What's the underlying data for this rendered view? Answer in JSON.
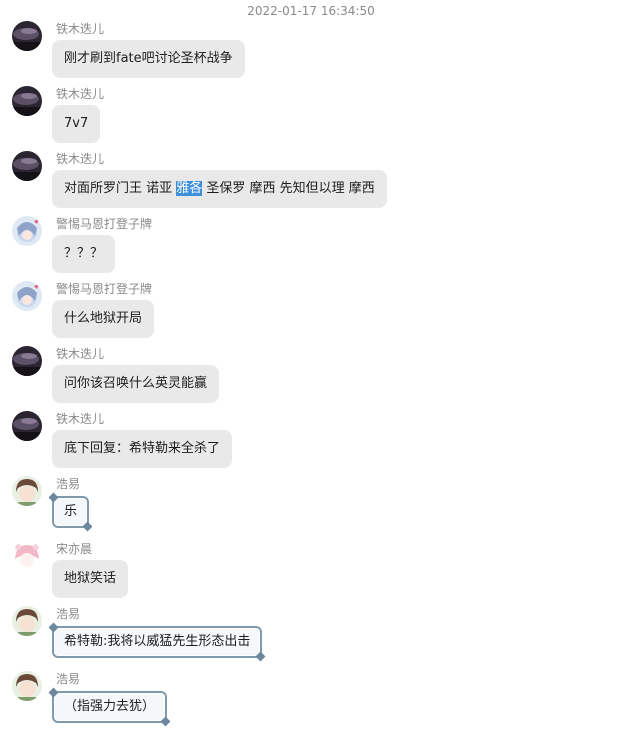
{
  "chat": {
    "timestamp": "2022-01-17 16:34:50",
    "messages": [
      {
        "sender": "铁木迭儿",
        "text": "刚才刷到fate吧讨论圣杯战争",
        "avatar": "night-sky-avatar"
      },
      {
        "sender": "铁木迭儿",
        "text": "7v7",
        "avatar": "night-sky-avatar"
      },
      {
        "sender": "铁木迭儿",
        "text_before": "对面所罗门王 诺亚 ",
        "text_highlight": "雅各",
        "text_after": " 圣保罗 摩西 先知但以理 摩西",
        "avatar": "night-sky-avatar"
      },
      {
        "sender": "警惕马恩打登子牌",
        "text": "？？？",
        "avatar": "anime-girl-avatar"
      },
      {
        "sender": "警惕马恩打登子牌",
        "text": "什么地狱开局",
        "avatar": "anime-girl-avatar"
      },
      {
        "sender": "铁木迭儿",
        "text": "问你该召唤什么英灵能赢",
        "avatar": "night-sky-avatar"
      },
      {
        "sender": "铁木迭儿",
        "text": "底下回复：希特勒来全杀了",
        "avatar": "night-sky-avatar"
      },
      {
        "sender": "浩易",
        "text": "乐",
        "avatar": "anime-boy-avatar"
      },
      {
        "sender": "宋亦晨",
        "text": "地狱笑话",
        "avatar": "pink-hair-avatar"
      },
      {
        "sender": "浩易",
        "text": "希特勒:我将以威猛先生形态出击",
        "avatar": "anime-boy-avatar"
      },
      {
        "sender": "浩易",
        "text": "（指强力去犹）",
        "avatar": "anime-boy-avatar"
      }
    ]
  },
  "colors": {
    "bubble": "#e9e9e9",
    "framed_bubble_border": "#7f99ad",
    "highlight": "#3d8fd9",
    "meta_text": "#8a8a8a"
  }
}
